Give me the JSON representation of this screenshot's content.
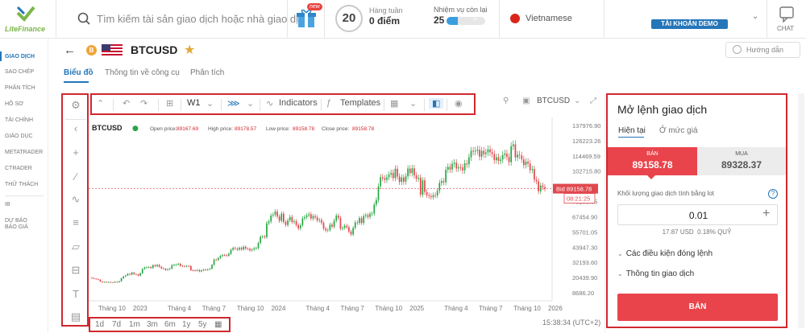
{
  "brand": {
    "logo_text": "LiteFinance"
  },
  "search": {
    "placeholder": "Tìm kiếm tài sản giao dịch hoặc nhà giao dịch"
  },
  "gift": {
    "badge": "new"
  },
  "weekly": {
    "level": "20",
    "label": "Hàng tuần",
    "points": "0 điểm"
  },
  "missions": {
    "label": "Nhiệm vụ còn lại",
    "count": "25",
    "progress": 0.3
  },
  "language": {
    "name": "Vietnamese"
  },
  "account": {
    "label": "TÀI KHOẢN DEMO"
  },
  "chat": {
    "label": "CHAT"
  },
  "sidebar": {
    "items": [
      {
        "label": "GIAO DỊCH",
        "active": true
      },
      {
        "label": "SAO CHÉP"
      },
      {
        "label": "PHÂN TÍCH"
      },
      {
        "label": "HỒ SƠ"
      },
      {
        "label": "TÀI CHÍNH"
      },
      {
        "label": "GIÁO DỤC"
      },
      {
        "label": "METATRADER"
      },
      {
        "label": "CTRADER"
      },
      {
        "label": "THỬ THÁCH"
      },
      {
        "label": "IB"
      },
      {
        "label": "DỰ BÁO"
      },
      {
        "label": "BÁO GIÁ"
      }
    ]
  },
  "instrument": {
    "coin_letter": "B",
    "symbol": "BTCUSD",
    "guide": "Hướng dẫn"
  },
  "tabs": [
    {
      "label": "Biểu đồ",
      "active": true
    },
    {
      "label": "Thông tin về công cụ"
    },
    {
      "label": "Phân tích"
    }
  ],
  "toolbar": {
    "interval": "W1",
    "indicators": "Indicators",
    "templates": "Templates",
    "symbol": "BTCUSD"
  },
  "ranges": [
    "1d",
    "7d",
    "1m",
    "3m",
    "6m",
    "1y",
    "5y"
  ],
  "timestamp": "15:38:34 (UTC+2)",
  "chart_data": {
    "type": "candlestick",
    "symbol": "BTCUSD",
    "legend_status": "●",
    "ohlc_labels": {
      "open": "Open price:",
      "open_value": "89167.69",
      "high": "High price:",
      "high_value": "89178.57",
      "low": "Low price:",
      "low_value": "89158.78",
      "close": "Close price:",
      "close_value": "89158.78"
    },
    "y_ticks": [
      "137976.90",
      "126223.26",
      "114469.59",
      "102715.80",
      "90962.22",
      "79208.55",
      "67454.90",
      "55701.05",
      "43947.30",
      "32193.60",
      "20439.90",
      "8686.20"
    ],
    "y_range": [
      8686.2,
      137976.9
    ],
    "x_ticks": [
      "Tháng 10",
      "2023",
      "Tháng 4",
      "Tháng 7",
      "Tháng 10",
      "2024",
      "Tháng 4",
      "Tháng 7",
      "Tháng 10",
      "2025",
      "Tháng 4",
      "Tháng 7",
      "Tháng 10",
      "2026"
    ],
    "bid": {
      "label": "Bid 89158.78",
      "value": 89158.78,
      "countdown": "08:21:25"
    },
    "closes": [
      20100,
      19600,
      19300,
      18800,
      17400,
      16900,
      17100,
      16700,
      17000,
      16800,
      16600,
      17200,
      16900,
      17600,
      19900,
      21300,
      22100,
      23300,
      22700,
      24300,
      23100,
      22900,
      21900,
      23800,
      27100,
      28200,
      28400,
      28600,
      27800,
      30000,
      29200,
      30200,
      28800,
      27600,
      27200,
      26300,
      26900,
      27400,
      30000,
      30300,
      30500,
      31100,
      29500,
      29300,
      29100,
      29400,
      29300,
      26100,
      26000,
      25800,
      26300,
      25200,
      26000,
      26600,
      26300,
      26800,
      27300,
      30200,
      34300,
      34100,
      35500,
      37100,
      37800,
      37700,
      37400,
      38800,
      41900,
      43300,
      42800,
      42100,
      43400,
      42200,
      44200,
      42800,
      42600,
      41500,
      42100,
      43100,
      43200,
      47200,
      51900,
      52100,
      51700,
      62500,
      63800,
      68400,
      69000,
      71500,
      67700,
      64300,
      69800,
      63400,
      61100,
      64700,
      67300,
      63400,
      64000,
      61000,
      58400,
      60900,
      66200,
      67200,
      68500,
      69400,
      66100,
      67900,
      67000,
      64600,
      64900,
      62700,
      58300,
      56900,
      57200,
      61300,
      59800,
      64400,
      68300,
      66600,
      58200,
      58900,
      60500,
      59400,
      56000,
      53800,
      58800,
      63100,
      62700,
      66400,
      62600,
      68000,
      68700,
      67300,
      69700,
      69900,
      76900,
      80400,
      91000,
      98000,
      97200,
      95900,
      98000,
      100000,
      101400,
      97300,
      104500,
      98500,
      94300,
      97800,
      94600,
      98700,
      104700,
      101100,
      104900,
      99400,
      96800,
      97600,
      84500,
      95600,
      86600,
      84100,
      83400,
      82600,
      84100,
      83900,
      87500,
      93600,
      95000,
      94100,
      103700,
      106000,
      104000,
      108300,
      109200,
      104700,
      105800,
      105600,
      103300,
      108700,
      108000,
      113400,
      118400,
      117800,
      118500,
      119300,
      113900,
      118400,
      115800,
      117200,
      119500,
      117300,
      115900,
      111200,
      113400,
      110600,
      111700,
      115200,
      116300,
      113700,
      109600,
      122000,
      123400,
      113300,
      115400,
      114800,
      111800,
      107400,
      110000,
      108500,
      103500,
      104300,
      96100,
      94900,
      87100,
      91500,
      90400,
      89158
    ]
  }
}
